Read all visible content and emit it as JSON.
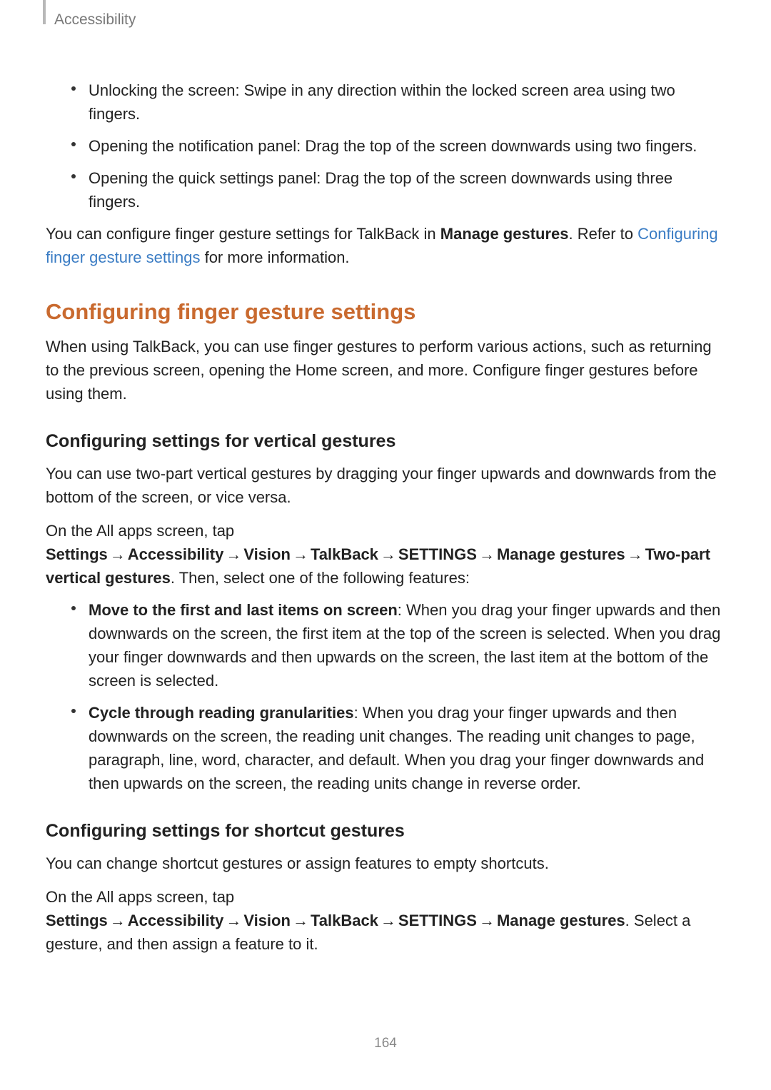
{
  "header": {
    "title": "Accessibility"
  },
  "bullets_top": {
    "b1": "Unlocking the screen: Swipe in any direction within the locked screen area using two fingers.",
    "b2": "Opening the notification panel: Drag the top of the screen downwards using two fingers.",
    "b3": "Opening the quick settings panel: Drag the top of the screen downwards using three fingers."
  },
  "para1": {
    "seg1": "You can configure finger gesture settings for TalkBack in ",
    "bold1": "Manage gestures",
    "seg2": ". Refer to ",
    "link": "Configuring finger gesture settings",
    "seg3": " for more information."
  },
  "h2": "Configuring finger gesture settings",
  "para2": "When using TalkBack, you can use finger gestures to perform various actions, such as returning to the previous screen, opening the Home screen, and more. Configure finger gestures before using them.",
  "h3a": "Configuring settings for vertical gestures",
  "para3": "You can use two-part vertical gestures by dragging your finger upwards and downwards from the bottom of the screen, or vice versa.",
  "path_vertical": {
    "intro": "On the All apps screen, tap ",
    "settings": "Settings",
    "accessibility": "Accessibility",
    "vision": "Vision",
    "talkback": "TalkBack",
    "settings_caps": "SETTINGS",
    "manage": "Manage gestures",
    "twopart": "Two-part vertical gestures",
    "outro": ". Then, select one of the following features:"
  },
  "arrow": "→",
  "bullets_vertical": {
    "b1_bold": "Move to the first and last items on screen",
    "b1_text": ": When you drag your finger upwards and then downwards on the screen, the first item at the top of the screen is selected. When you drag your finger downwards and then upwards on the screen, the last item at the bottom of the screen is selected.",
    "b2_bold": "Cycle through reading granularities",
    "b2_text": ": When you drag your finger upwards and then downwards on the screen, the reading unit changes. The reading unit changes to page, paragraph, line, word, character, and default. When you drag your finger downwards and then upwards on the screen, the reading units change in reverse order."
  },
  "h3b": "Configuring settings for shortcut gestures",
  "para4": "You can change shortcut gestures or assign features to empty shortcuts.",
  "path_shortcut": {
    "intro": "On the All apps screen, tap ",
    "settings": "Settings",
    "accessibility": "Accessibility",
    "vision": "Vision",
    "talkback": "TalkBack",
    "settings_caps": "SETTINGS",
    "manage": "Manage gestures",
    "outro": ". Select a gesture, and then assign a feature to it."
  },
  "page_number": "164"
}
